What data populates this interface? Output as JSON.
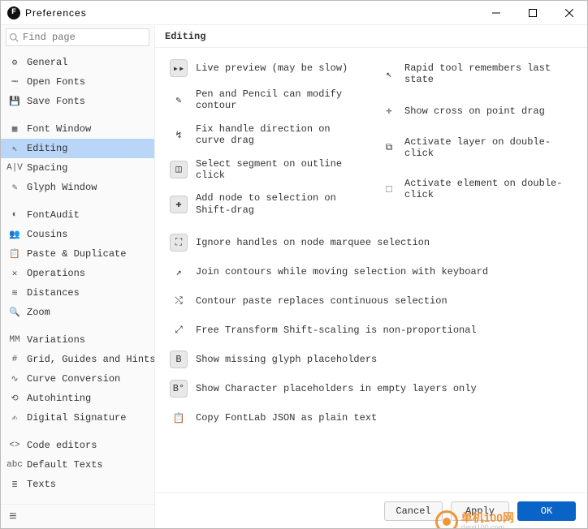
{
  "window": {
    "title": "Preferences"
  },
  "search": {
    "placeholder": "Find page"
  },
  "sidebar": {
    "groups": [
      {
        "items": [
          {
            "label": "General",
            "icon": "gear"
          },
          {
            "label": "Open Fonts",
            "icon": "open"
          },
          {
            "label": "Save Fonts",
            "icon": "save"
          }
        ]
      },
      {
        "items": [
          {
            "label": "Font Window",
            "icon": "grid"
          },
          {
            "label": "Editing",
            "icon": "cursor",
            "active": true
          },
          {
            "label": "Spacing",
            "icon": "spacing"
          },
          {
            "label": "Glyph Window",
            "icon": "glyph"
          }
        ]
      },
      {
        "items": [
          {
            "label": "FontAudit",
            "icon": "yinyang"
          },
          {
            "label": "Cousins",
            "icon": "people"
          },
          {
            "label": "Paste & Duplicate",
            "icon": "paste"
          },
          {
            "label": "Operations",
            "icon": "tools"
          },
          {
            "label": "Distances",
            "icon": "distance"
          },
          {
            "label": "Zoom",
            "icon": "zoom"
          }
        ]
      },
      {
        "items": [
          {
            "label": "Variations",
            "icon": "variations"
          },
          {
            "label": "Grid, Guides and Hints",
            "icon": "hash"
          },
          {
            "label": "Curve Conversion",
            "icon": "curve"
          },
          {
            "label": "Autohinting",
            "icon": "autohint"
          },
          {
            "label": "Digital Signature",
            "icon": "signature"
          }
        ]
      },
      {
        "items": [
          {
            "label": "Code editors",
            "icon": "code"
          },
          {
            "label": "Default Texts",
            "icon": "defaulttext"
          },
          {
            "label": "Texts",
            "icon": "texts"
          }
        ]
      }
    ]
  },
  "main": {
    "heading": "Editing",
    "left": [
      {
        "label": "Live preview (may be slow)",
        "icon": "▸▸",
        "active": true
      },
      {
        "label": "Pen and Pencil can modify contour",
        "icon": "✎",
        "active": false
      },
      {
        "label": "Fix handle direction on curve drag",
        "icon": "↯",
        "active": false
      },
      {
        "label": "Select segment on outline click",
        "icon": "◫",
        "active": true
      },
      {
        "label": "Add node to selection on Shift-drag",
        "icon": "✚",
        "active": true
      }
    ],
    "right": [
      {
        "label": "Rapid tool remembers last state",
        "icon": "↖"
      },
      {
        "label": "Show cross on point drag",
        "icon": "✛"
      },
      {
        "label": "Activate layer on double-click",
        "icon": "⧉",
        "active": true
      },
      {
        "label": "Activate element on double-click",
        "icon": "⬚"
      }
    ],
    "stack": [
      {
        "label": "Ignore handles on node marquee selection",
        "icon": "⛶",
        "active": true
      },
      {
        "label": "Join contours while moving selection with keyboard",
        "icon": "↗",
        "active": false
      },
      {
        "label": "Contour paste replaces continuous selection",
        "icon": "⤭",
        "active": false
      },
      {
        "label": "Free Transform Shift-scaling is non-proportional",
        "icon": "⤢",
        "active": false
      },
      {
        "label": "Show missing glyph placeholders",
        "icon": "B",
        "active": true
      },
      {
        "label": "Show Character placeholders in empty layers only",
        "icon": "B°",
        "active": true
      },
      {
        "label": "Copy FontLab JSON as plain text",
        "icon": "📋",
        "active": false
      }
    ]
  },
  "footer": {
    "cancel": "Cancel",
    "apply": "Apply",
    "ok": "OK"
  },
  "watermark": {
    "line1": "单机100网",
    "line2": "danji100.com"
  },
  "icons": {
    "gear": "⚙",
    "open": "⭲",
    "save": "💾",
    "grid": "▦",
    "cursor": "↖",
    "spacing": "A|V",
    "glyph": "✎",
    "yinyang": "◐",
    "people": "👥",
    "paste": "📋",
    "tools": "✕",
    "distance": "≋",
    "zoom": "🔍",
    "variations": "MM",
    "hash": "#",
    "curve": "∿",
    "autohint": "⟲",
    "signature": "✍",
    "code": "<>",
    "defaulttext": "abc",
    "texts": "≣",
    "menu": "≡"
  }
}
